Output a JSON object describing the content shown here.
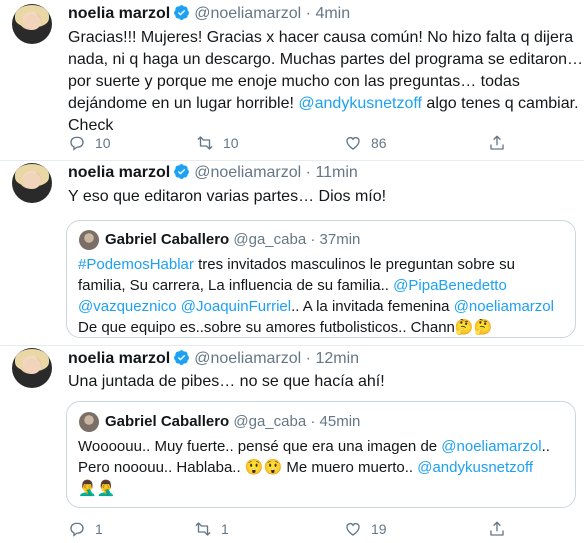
{
  "tweet1": {
    "name": "noelia marzol",
    "handle": "@noeliamarzol",
    "time": "4min",
    "lines": [
      "Gracias!!! Mujeres! Gracias x hacer causa común! No hizo falta q dijera",
      "nada, ni q haga un descargo. Muchas partes del programa se editaron…",
      "por suerte y porque me enoje mucho con las preguntas… todas",
      "dejándome en un lugar horrible!",
      "@andykusnetzoff",
      "algo tenes q cambiar.",
      "Check"
    ],
    "replies": "10",
    "retweets": "10",
    "likes": "86"
  },
  "tweet2": {
    "name": "noelia marzol",
    "handle": "@noeliamarzol",
    "time": "11min",
    "text": "Y eso que editaron varias partes… Dios mío!",
    "quote": {
      "name": "Gabriel Caballero",
      "handle": "@ga_caba",
      "time": "37min",
      "lines": [
        "#PodemosHablar tres invitados masculinos le preguntan sobre su",
        "familia, Su carrera, La influencia de su familia.. @PipaBenedetto",
        "@vazqueznico @JoaquinFurriel.. A la invitada femenina @noeliamarzol",
        "De que equipo es..sobre su amores futbolisticos.. Chann"
      ],
      "emojis": "🤔🤔"
    }
  },
  "tweet3": {
    "name": "noelia marzol",
    "handle": "@noeliamarzol",
    "time": "12min",
    "text": "Una juntada de pibes… no se que hacía ahí!",
    "quote": {
      "name": "Gabriel Caballero",
      "handle": "@ga_caba",
      "time": "45min",
      "line1": "Woooouu.. Muy fuerte.. pensé que era una imagen de @noeliamarzol..",
      "line2_a": "Pero nooouu.. Hablaba..",
      "line2_emojis": "😲😲",
      "line2_b": "Me muero muerto.. @andykusnetzoff",
      "line3_emojis": "🤦‍♂️🤦‍♂️"
    },
    "replies": "1",
    "retweets": "1",
    "likes": "19"
  },
  "colors": {
    "link": "#1da1f2",
    "muted": "#657786",
    "verified": "#1da1f2",
    "border": "#ccd6dd"
  }
}
